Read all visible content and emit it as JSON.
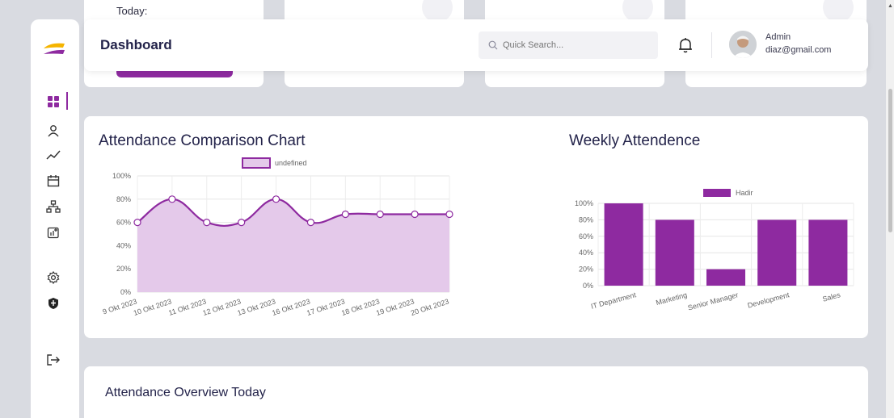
{
  "header": {
    "title": "Dashboard",
    "search_placeholder": "Quick Search...",
    "user_role": "Admin",
    "user_email": "diaz@gmail.com"
  },
  "top_cards": {
    "today_label": "Today:"
  },
  "sidebar": {
    "items": [
      {
        "name": "dashboard",
        "icon": "grid-icon"
      },
      {
        "name": "users",
        "icon": "user-icon"
      },
      {
        "name": "analytics",
        "icon": "trend-icon"
      },
      {
        "name": "calendar",
        "icon": "calendar-icon"
      },
      {
        "name": "organization",
        "icon": "hierarchy-icon"
      },
      {
        "name": "reports",
        "icon": "chart-add-icon"
      },
      {
        "name": "settings",
        "icon": "gear-icon"
      },
      {
        "name": "security",
        "icon": "shield-icon"
      },
      {
        "name": "logout",
        "icon": "logout-icon"
      }
    ]
  },
  "attendance_chart": {
    "title": "Attendance Comparison Chart"
  },
  "weekly_chart": {
    "title": "Weekly Attendence"
  },
  "overview": {
    "title": "Attendance Overview Today"
  },
  "colors": {
    "accent": "#8e2aa0",
    "area_fill": "#e4c9ea",
    "background": "#d9dbe1"
  },
  "chart_data": [
    {
      "type": "area",
      "legend": "undefined",
      "categories": [
        "9 Okt 2023",
        "10 Okt 2023",
        "11 Okt 2023",
        "12 Okt 2023",
        "13 Okt 2023",
        "16 Okt 2023",
        "17 Okt 2023",
        "18 Okt 2023",
        "19 Okt 2023",
        "20 Okt 2023"
      ],
      "values": [
        60,
        80,
        60,
        60,
        80,
        60,
        67,
        67,
        67,
        67
      ],
      "ylim": [
        0,
        100
      ],
      "yticks": [
        "0%",
        "20%",
        "40%",
        "60%",
        "80%",
        "100%"
      ],
      "grid": true,
      "legend_position": "top"
    },
    {
      "type": "bar",
      "legend": "Hadir",
      "categories": [
        "IT Department",
        "Marketing",
        "Senior Manager",
        "Development",
        "Sales"
      ],
      "values": [
        100,
        80,
        20,
        80,
        80
      ],
      "ylim": [
        0,
        100
      ],
      "yticks": [
        "0%",
        "20%",
        "40%",
        "60%",
        "80%",
        "100%"
      ],
      "grid": true,
      "legend_position": "top"
    }
  ]
}
